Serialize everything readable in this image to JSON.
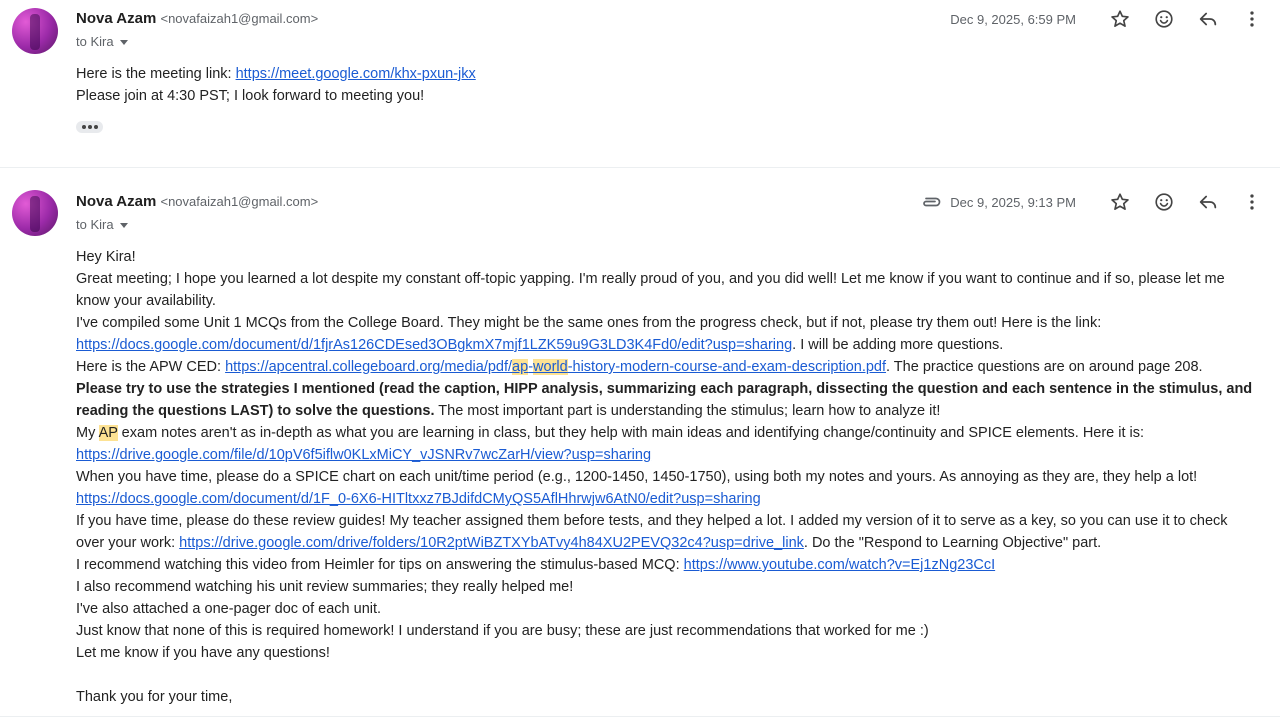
{
  "messages": [
    {
      "sender_name": "Nova Azam",
      "sender_email": "<novafaizah1@gmail.com>",
      "to": "to Kira",
      "date": "Dec 9, 2025, 6:59 PM",
      "lines": [
        {
          "pre": "Here is the meeting link: ",
          "link": "https://meet.google.com/khx-pxun-jkx"
        },
        {
          "text": "Please join at 4:30 PST; I look forward to meeting you!"
        }
      ]
    },
    {
      "sender_name": "Nova Azam",
      "sender_email": "<novafaizah1@gmail.com>",
      "to": "to Kira",
      "date": "Dec 9, 2025, 9:13 PM",
      "greeting": "Hey Kira!",
      "p1": "Great meeting; I hope you learned a lot despite my constant off-topic yapping. I'm really proud of you, and you did well! Let me know if you want to continue and if so, please let me know your availability.",
      "p2_pre": "I've compiled some Unit 1 MCQs from the College Board. They might be the same ones from the progress check, but if not, please try them out! Here is the link: ",
      "p2_link": "https://docs.google.com/document/d/1fjrAs126CDEsed3OBgkmX7mjf1LZK59u9G3LD3K4Fd0/edit?usp=sharing",
      "p2_post": ". I will be adding more questions.",
      "p3_pre": "Here is the APW CED: ",
      "p3_link_a": "https://apcentral.collegeboard.org/media/pdf/",
      "p3_link_hl1": "ap",
      "p3_link_b": "-",
      "p3_link_hl2": "world",
      "p3_link_c": "-history-modern-course-and-exam-description.pdf",
      "p3_post": ". The practice questions are on around page 208.",
      "p4_bold": "Please try to use the strategies I mentioned (read the caption, HIPP analysis, summarizing each paragraph, dissecting the question and each sentence in the stimulus, and reading the questions LAST) to solve the questions.",
      "p4_post": " The most important part is understanding the stimulus; learn how to analyze it!",
      "p5_a": "My ",
      "p5_hl": "AP",
      "p5_b": " exam notes aren't as in-depth as what you are learning in class, but they help with main ideas and identifying change/continuity and SPICE elements. Here it is: ",
      "p5_link": "https://drive.google.com/file/d/10pV6f5iflw0KLxMiCY_vJSNRv7wcZarH/view?usp=sharing",
      "p6_pre": "When you have time, please do a SPICE chart on each unit/time period (e.g., 1200-1450, 1450-1750), using both my notes and yours. As annoying as they are, they help a lot! ",
      "p6_link": "https://docs.google.com/document/d/1F_0-6X6-HITltxxz7BJdifdCMyQS5AflHhrwjw6AtN0/edit?usp=sharing",
      "p7_pre": "If you have time, please do these review guides! My teacher assigned them before tests, and they helped a lot. I added my version of it to serve as a key, so you can use it to check over your work: ",
      "p7_link": "https://drive.google.com/drive/folders/10R2ptWiBZTXYbATvy4h84XU2PEVQ32c4?usp=drive_link",
      "p7_post": ". Do the \"Respond to Learning Objective\" part.",
      "p8_pre": "I recommend watching this video from Heimler for tips on answering the stimulus-based MCQ: ",
      "p8_link": "https://www.youtube.com/watch?v=Ej1zNg23CcI",
      "p9": "I also recommend watching his unit review summaries; they really helped me!",
      "p10": "I've also attached a one-pager doc of each unit.",
      "p11": "Just know that none of this is required homework! I understand if you are busy; these are just recommendations that worked for me :)",
      "p12": "Let me know if you have any questions!",
      "closing": "Thank you for your time,"
    }
  ],
  "icons": [
    "star-icon",
    "emoji-icon",
    "reply-icon",
    "more-vert-icon",
    "attachment-icon"
  ],
  "colors": {
    "link": "#1a5bd3",
    "highlight": "#fde293",
    "muted": "#5f6368"
  }
}
